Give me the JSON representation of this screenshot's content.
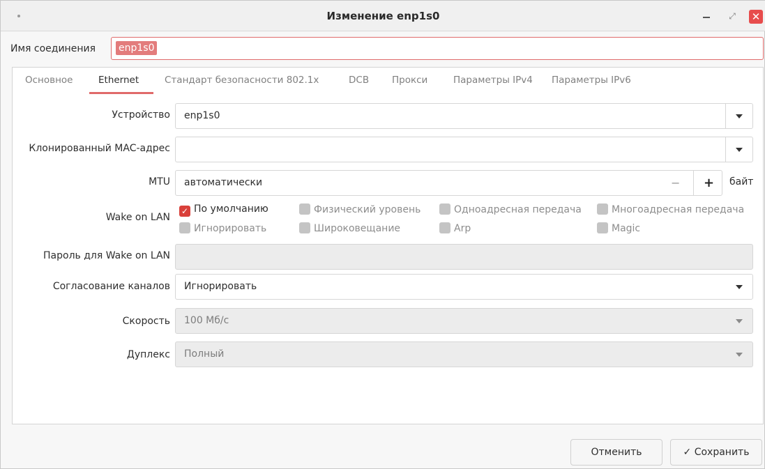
{
  "window": {
    "title": "Изменение enp1s0",
    "close_glyph": "✕",
    "maximize_glyph": "⤢"
  },
  "connection": {
    "label": "Имя соединения",
    "value": "enp1s0"
  },
  "tabs": [
    {
      "label": "Основное"
    },
    {
      "label": "Ethernet"
    },
    {
      "label": "Стандарт безопасности 802.1x"
    },
    {
      "label": "DCB"
    },
    {
      "label": "Прокси"
    },
    {
      "label": "Параметры IPv4"
    },
    {
      "label": "Параметры IPv6"
    }
  ],
  "active_tab": "Ethernet",
  "ethernet": {
    "device": {
      "label": "Устройство",
      "value": "enp1s0"
    },
    "cloned_mac": {
      "label": "Клонированный MAC-адрес",
      "value": ""
    },
    "mtu": {
      "label": "MTU",
      "value": "автоматически",
      "minus": "−",
      "plus": "+",
      "unit": "байт"
    },
    "wol": {
      "label": "Wake on LAN",
      "options": [
        {
          "label": "По умолчанию",
          "checked": true
        },
        {
          "label": "Физический уровень",
          "checked": false
        },
        {
          "label": "Одноадресная передача",
          "checked": false
        },
        {
          "label": "Многоадресная передача",
          "checked": false
        },
        {
          "label": "Игнорировать",
          "checked": false
        },
        {
          "label": "Широковещание",
          "checked": false
        },
        {
          "label": "Arp",
          "checked": false
        },
        {
          "label": "Magic",
          "checked": false
        }
      ],
      "check_glyph": "✓"
    },
    "wol_password": {
      "label": "Пароль для Wake on LAN",
      "value": ""
    },
    "autoneg": {
      "label": "Согласование каналов",
      "value": "Игнорировать"
    },
    "speed": {
      "label": "Скорость",
      "value": "100 Мб/с"
    },
    "duplex": {
      "label": "Дуплекс",
      "value": "Полный"
    }
  },
  "buttons": {
    "cancel": "Отменить",
    "save": "✓ Сохранить"
  },
  "colors": {
    "accent": "#e06a6a",
    "checkbox_checked": "#d9403a",
    "close_button": "#e74c4c"
  }
}
